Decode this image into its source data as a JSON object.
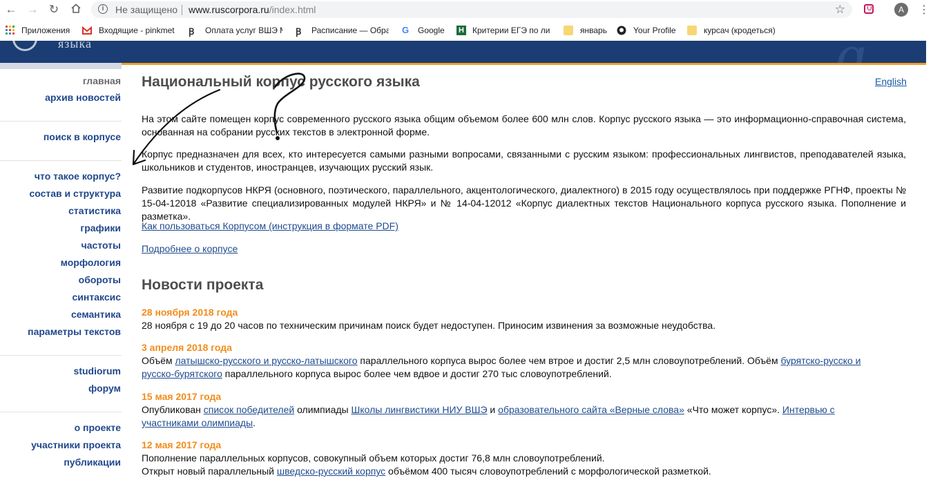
{
  "browser": {
    "not_secure": "Не защищено",
    "url_domain": "www.ruscorpora.ru",
    "url_path": "/index.html",
    "avatar_letter": "A"
  },
  "bookmarks": [
    {
      "label": "Приложения",
      "icon": "apps-grid-icon"
    },
    {
      "label": "Входящие - pinkmet",
      "icon": "gmail-icon"
    },
    {
      "label": "Оплата услуг ВШЭ М",
      "icon": "hse-icon"
    },
    {
      "label": "Расписание — Обра",
      "icon": "hse-icon"
    },
    {
      "label": "Google",
      "icon": "google-icon"
    },
    {
      "label": "Критерии ЕГЭ по ли",
      "icon": "h-icon"
    },
    {
      "label": "январь",
      "icon": "folder-icon"
    },
    {
      "label": "Your Profile",
      "icon": "github-icon"
    },
    {
      "label": "курсач (кродеться)",
      "icon": "folder-icon"
    }
  ],
  "site": {
    "brand_text": "языка"
  },
  "sidebar": {
    "items": [
      {
        "label": "главная"
      },
      {
        "label": "архив новостей"
      },
      {
        "label": "поиск в корпусе"
      },
      {
        "label": "что такое корпус?"
      },
      {
        "label": "состав и структура"
      },
      {
        "label": "статистика"
      },
      {
        "label": "графики"
      },
      {
        "label": "частоты"
      },
      {
        "label": "морфология"
      },
      {
        "label": "обороты"
      },
      {
        "label": "синтаксис"
      },
      {
        "label": "семантика"
      },
      {
        "label": "параметры текстов"
      },
      {
        "label": "studiorum"
      },
      {
        "label": "форум"
      },
      {
        "label": "о проекте"
      },
      {
        "label": "участники проекта"
      },
      {
        "label": "публикации"
      }
    ]
  },
  "main": {
    "title": "Национальный корпус русского языка",
    "english_link": "English",
    "para1": "На этом сайте помещен корпус современного русского языка общим объемом более 600 млн слов. Корпус русского языка — это информационно-справочная система, основанная на собрании русских текстов в электронной форме.",
    "para2": "Корпус предназначен для всех, кто интересуется самыми разными вопросами, связанными с русским языком: профессиональных лингвистов, преподавателей языка, школьников и студентов, иностранцев, изучающих русский язык.",
    "para3": "Развитие подкорпусов НКРЯ (основного, поэтического, параллельного, акцентологического, диалектного) в 2015 году осуществлялось при поддержке РГНФ, проекты № 15-04-12018 «Развитие специализированных модулей НКРЯ» и № 14-04-12012 «Корпус диалектных текстов Национального корпуса русского языка. Пополнение и разметка».",
    "link_howto": "Как пользоваться Корпусом (инструкция в формате PDF)",
    "link_more": "Подробнее о корпусе"
  },
  "news": {
    "title": "Новости проекта",
    "items": [
      {
        "date": "28 ноября 2018 года",
        "text": "28 ноября с 19 до 20 часов по техническим причинам поиск будет недоступен. Приносим извинения за возможные неудобства."
      },
      {
        "date": "3 апреля 2018 года",
        "t1": "Объём ",
        "l1": "латышско-русского и русско-латышского",
        "t2": " параллельного корпуса вырос более чем втрое и достиг 2,5 млн словоупотреблений. Объём ",
        "l2": "бурятско-русско и русско-бурятского",
        "t3": " параллельного корпуса вырос более чем вдвое и достиг 270 тыс словоупотреблений."
      },
      {
        "date": "15 мая 2017 года",
        "t1": "Опубликован ",
        "l1": "список победителей",
        "t2": " олимпиады ",
        "l2": "Школы лингвистики НИУ ВШЭ",
        "t3": " и ",
        "l3": "образовательного сайта «Верные слова»",
        "t4": " «Что может корпус». ",
        "l4": "Интервью с участниками олимпиады",
        "t5": "."
      },
      {
        "date": "12 мая 2017 года",
        "text": "Пополнение параллельных корпусов, совокупный объем которых достиг 76,8 млн словоупотреблений.",
        "t1": "Открыт новый параллельный ",
        "l1": "шведско-русский корпус",
        "t2": " объёмом 400 тысяч словоупотреблений с морфологической разметкой."
      }
    ]
  }
}
